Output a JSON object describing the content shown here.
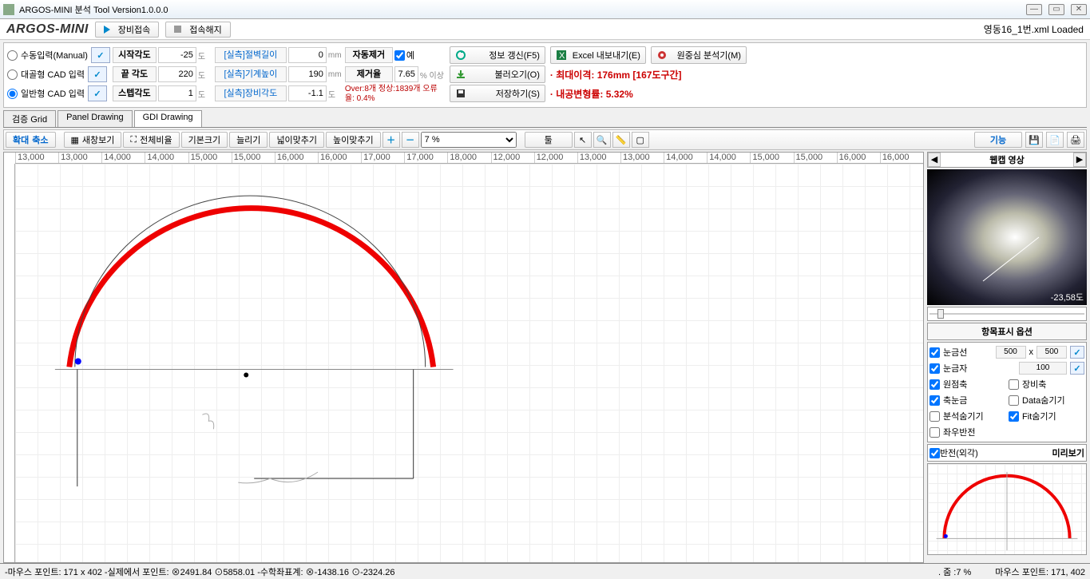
{
  "title": "ARGOS-MINI 분석 Tool Version1.0.0.0",
  "logo": "ARGOS-MINI",
  "header": {
    "connect": "장비접속",
    "disconnect": "접속해지",
    "loaded": "영동16_1번.xml Loaded"
  },
  "input_modes": {
    "manual": "수동입력(Manual)",
    "skel": "대골형 CAD 입력",
    "normal": "일반형 CAD 입력"
  },
  "angles": {
    "start_lbl": "시작각도",
    "start_val": "-25",
    "start_unit": "도",
    "end_lbl": "끝 각도",
    "end_val": "220",
    "end_unit": "도",
    "step_lbl": "스텝각도",
    "step_val": "1",
    "step_unit": "도"
  },
  "measured": {
    "wall_lbl": "[실측]절벽길이",
    "wall_val": "0",
    "wall_unit": "mm",
    "machine_lbl": "[실측]기계높이",
    "machine_val": "190",
    "machine_unit": "mm",
    "equip_lbl": "[실측]장비각도",
    "equip_val": "-1.1",
    "equip_unit": "도"
  },
  "removal": {
    "auto_lbl": "자동제거",
    "yes": "예",
    "rate_lbl": "제거율",
    "rate_val": "7.65",
    "rate_unit": "% 이상",
    "over_line1": "Over:8개 정상:1839개 오류",
    "over_line2": "율: 0.4%"
  },
  "actions": {
    "refresh": "정보 갱신(F5)",
    "excel": "Excel 내보내기(E)",
    "analyze": "원중심 분석기(M)",
    "load": "불러오기(O)",
    "save": "저장하기(S)"
  },
  "results": {
    "max_gap": "· 최대이격: 176mm [167도구간]",
    "deform": "· 내공변형률: 5.32%"
  },
  "tabs": {
    "grid": "검증 Grid",
    "panel": "Panel Drawing",
    "gdi": "GDI Drawing"
  },
  "toolbar": {
    "zoomin": "확대",
    "zoomout": "축소",
    "refresh": "새창보기",
    "fitall": "전체비율",
    "default": "기본크기",
    "widen": "늘리기",
    "fitw": "넓이맞추기",
    "fith": "높이맞추기",
    "zoom_val": "7 %",
    "tool": "툴",
    "func": "기능"
  },
  "ruler": [
    "13,000",
    "13,000",
    "14,000",
    "14,000",
    "15,000",
    "15,000",
    "16,000",
    "16,000",
    "17,000",
    "17,000",
    "18,000",
    "12,000",
    "12,000",
    "13,000",
    "13,000",
    "14,000",
    "14,000",
    "15,000",
    "15,000",
    "16,000",
    "16,000"
  ],
  "webcam": {
    "title": "웹캡 영상",
    "angle": "-23,58도"
  },
  "display_opts": {
    "title": "항목표시 옵션",
    "grid": "눈금선",
    "grid_a": "500",
    "x": "x",
    "grid_b": "500",
    "ruler": "눈금자",
    "ruler_v": "100",
    "orig_axis": "원점축",
    "equip_axis": "장비축",
    "axis_grid": "축눈금",
    "data_hide": "Data숨기기",
    "anal_hide": "분석숨기기",
    "fit_hide": "Fit숨기기",
    "mirror": "좌우반전",
    "invert": "반전(외각)",
    "preview": "미리보기"
  },
  "status": {
    "left": "-마우스 포인트: 171 x 402 -실제에서 포인트: ⊗2491.84 ⊙5858.01 -수학좌표계: ⊗-1438.16 ⊙-2324.26",
    "zoom": ". 줌 :7 %",
    "mouse": "마우스 포인트: 171, 402"
  }
}
